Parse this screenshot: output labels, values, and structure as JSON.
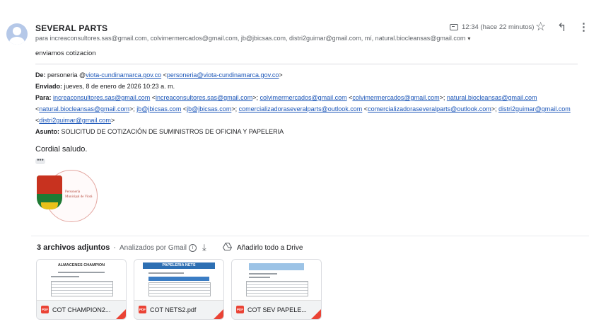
{
  "email": {
    "sender_name": "SEVERAL PARTS",
    "recipients_line": "para increaconsultores.sas@gmail.com, colvimermercados@gmail.com, jb@jbicsas.com, distri2guimar@gmail.com, mí, natural.biocleansas@gmail.com",
    "time": "12:34 (hace 22 minutos)",
    "snippet": "enviamos cotizacion"
  },
  "forwarded": {
    "de_label": "De:",
    "de_value": "personeria @viota-cundinamarca.gov.co",
    "de_link": "personeria@viota-cundinamarca.gov.co",
    "enviado_label": "Enviado:",
    "enviado_value": "jueves, 8 de enero de 2026 10:23 a. m.",
    "para_label": "Para:",
    "para": [
      {
        "addr": "increaconsultores.sas@gmail.com",
        "link": "increaconsultores.sas@gmail.com"
      },
      {
        "addr": "colvimermercados@gmail.com",
        "link": "colvimermercados@gmail.com"
      },
      {
        "addr": "natural.biocleansas@gmail.com",
        "link": "natural.biocleansas@gmail.com"
      },
      {
        "addr": "jb@jbicsas.com",
        "link": "jb@jbicsas.com"
      },
      {
        "addr": "comercializadoraseveralparts@outlook.com",
        "link": "comercializadoraseveralparts@outlook.com"
      },
      {
        "addr": "distri2guimar@gmail.com",
        "link": "distri2guimar@gmail.com"
      }
    ],
    "asunto_label": "Asunto:",
    "asunto_value": "SOLICITUD DE COTIZACIÓN DE SUMINISTROS DE OFICINA Y PAPELERIA"
  },
  "body": {
    "greeting": "Cordial saludo.",
    "ellipsis": "•••",
    "logo_text": "Personería Municipal de Viotá"
  },
  "attachments": {
    "count_label": "3 archivos adjuntos",
    "scan_label": "Analizados por Gmail",
    "info_glyph": "i",
    "drive_label": "Añadirlo todo a Drive",
    "files": [
      {
        "name": "COT CHAMPION2...",
        "thumb_title": "ALMACENES CHAMPION"
      },
      {
        "name": "COT NETS2.pdf",
        "thumb_title": "PAPELERIA NETS"
      },
      {
        "name": "COT SEV PAPELE...",
        "thumb_title": ""
      }
    ],
    "pdf_badge": "PDF"
  },
  "icons": {
    "star": "☆",
    "reply": "↰",
    "more": "⋮",
    "download": "⤓",
    "caret": "▾"
  },
  "colors": {
    "link": "#1a55b8",
    "pdf_red": "#ea4335",
    "avatar": "#b5c8e8"
  }
}
